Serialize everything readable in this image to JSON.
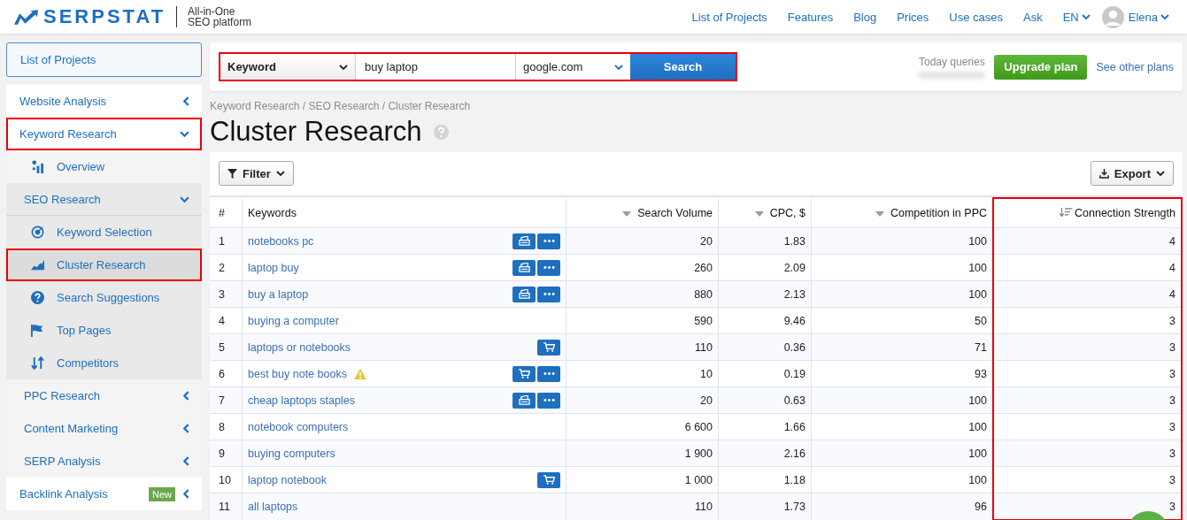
{
  "header": {
    "logo": "SERPSTAT",
    "tagline": [
      "All-in-One",
      "SEO platform"
    ],
    "nav": [
      "List of Projects",
      "Features",
      "Blog",
      "Prices",
      "Use cases",
      "Ask"
    ],
    "language": "EN",
    "user": "Elena"
  },
  "sidebar": {
    "projects_button": "List of Projects",
    "items": [
      {
        "label": "Website Analysis",
        "expanded": false,
        "highlighted": false
      },
      {
        "label": "Keyword Research",
        "expanded": true,
        "highlighted": true,
        "children": [
          {
            "label": "Overview",
            "kind": "overview",
            "selected": false,
            "highlighted": false
          },
          {
            "label": "SEO Research",
            "kind": "group",
            "expanded": true,
            "children": [
              {
                "label": "Keyword Selection",
                "kind": "target",
                "selected": false,
                "highlighted": false
              },
              {
                "label": "Cluster Research",
                "kind": "cluster",
                "selected": true,
                "highlighted": true
              },
              {
                "label": "Search Suggestions",
                "kind": "question",
                "selected": false,
                "highlighted": false
              },
              {
                "label": "Top Pages",
                "kind": "flag",
                "selected": false,
                "highlighted": false
              },
              {
                "label": "Competitors",
                "kind": "sort",
                "selected": false,
                "highlighted": false
              }
            ]
          },
          {
            "label": "PPC Research",
            "kind": "group",
            "expanded": false
          },
          {
            "label": "Content Marketing",
            "kind": "group",
            "expanded": false
          },
          {
            "label": "SERP Analysis",
            "kind": "group",
            "expanded": false
          }
        ]
      },
      {
        "label": "Backlink Analysis",
        "expanded": false,
        "highlighted": false,
        "badge": "New"
      }
    ]
  },
  "search": {
    "highlighted": true,
    "type": "Keyword",
    "query": "buy laptop",
    "engine": "google.com",
    "button": "Search",
    "queries_label": "Today queries",
    "upgrade": "Upgrade plan",
    "other_plans": "See other plans"
  },
  "breadcrumb": "Keyword Research / SEO Research / Cluster Research",
  "title": "Cluster Research",
  "toolbar": {
    "filter": "Filter",
    "export": "Export"
  },
  "table": {
    "columns": [
      {
        "label": "#",
        "sortable": false,
        "sorted": false,
        "highlighted": false
      },
      {
        "label": "Keywords",
        "sortable": false,
        "sorted": false,
        "highlighted": false
      },
      {
        "label": "Search Volume",
        "sortable": true,
        "sorted": false,
        "highlighted": false
      },
      {
        "label": "CPC, $",
        "sortable": true,
        "sorted": false,
        "highlighted": false
      },
      {
        "label": "Competition in PPC",
        "sortable": true,
        "sorted": false,
        "highlighted": false
      },
      {
        "label": "Connection Strength",
        "sortable": true,
        "sorted": true,
        "highlighted": true
      }
    ],
    "rows": [
      {
        "cells": [
          "1",
          "notebooks pc",
          "20",
          "1.83",
          "100",
          "4"
        ],
        "warning": false,
        "actions": [
          {
            "kind": "shop"
          },
          {
            "kind": "more"
          }
        ]
      },
      {
        "cells": [
          "2",
          "laptop buy",
          "260",
          "2.09",
          "100",
          "4"
        ],
        "warning": false,
        "actions": [
          {
            "kind": "shop"
          },
          {
            "kind": "more"
          }
        ]
      },
      {
        "cells": [
          "3",
          "buy a laptop",
          "880",
          "2.13",
          "100",
          "4"
        ],
        "warning": false,
        "actions": [
          {
            "kind": "shop"
          },
          {
            "kind": "more"
          }
        ]
      },
      {
        "cells": [
          "4",
          "buying a computer",
          "590",
          "9.46",
          "50",
          "3"
        ],
        "warning": false
      },
      {
        "cells": [
          "5",
          "laptops or notebooks",
          "110",
          "0.36",
          "71",
          "3"
        ],
        "warning": false,
        "actions": [
          {
            "kind": "cart"
          }
        ]
      },
      {
        "cells": [
          "6",
          "best buy note books",
          "10",
          "0.19",
          "93",
          "3"
        ],
        "warning": true,
        "actions": [
          {
            "kind": "cart"
          },
          {
            "kind": "more"
          }
        ]
      },
      {
        "cells": [
          "7",
          "cheap laptops staples",
          "20",
          "0.63",
          "100",
          "3"
        ],
        "warning": false,
        "actions": [
          {
            "kind": "shop"
          },
          {
            "kind": "more"
          }
        ]
      },
      {
        "cells": [
          "8",
          "notebook computers",
          "6 600",
          "1.66",
          "100",
          "3"
        ],
        "warning": false
      },
      {
        "cells": [
          "9",
          "buying computers",
          "1 900",
          "2.16",
          "100",
          "3"
        ],
        "warning": false
      },
      {
        "cells": [
          "10",
          "laptop notebook",
          "1 000",
          "1.18",
          "100",
          "3"
        ],
        "warning": false,
        "actions": [
          {
            "kind": "cart"
          }
        ]
      },
      {
        "cells": [
          "11",
          "all laptops",
          "110",
          "1.73",
          "96",
          "3"
        ],
        "warning": false
      }
    ]
  }
}
